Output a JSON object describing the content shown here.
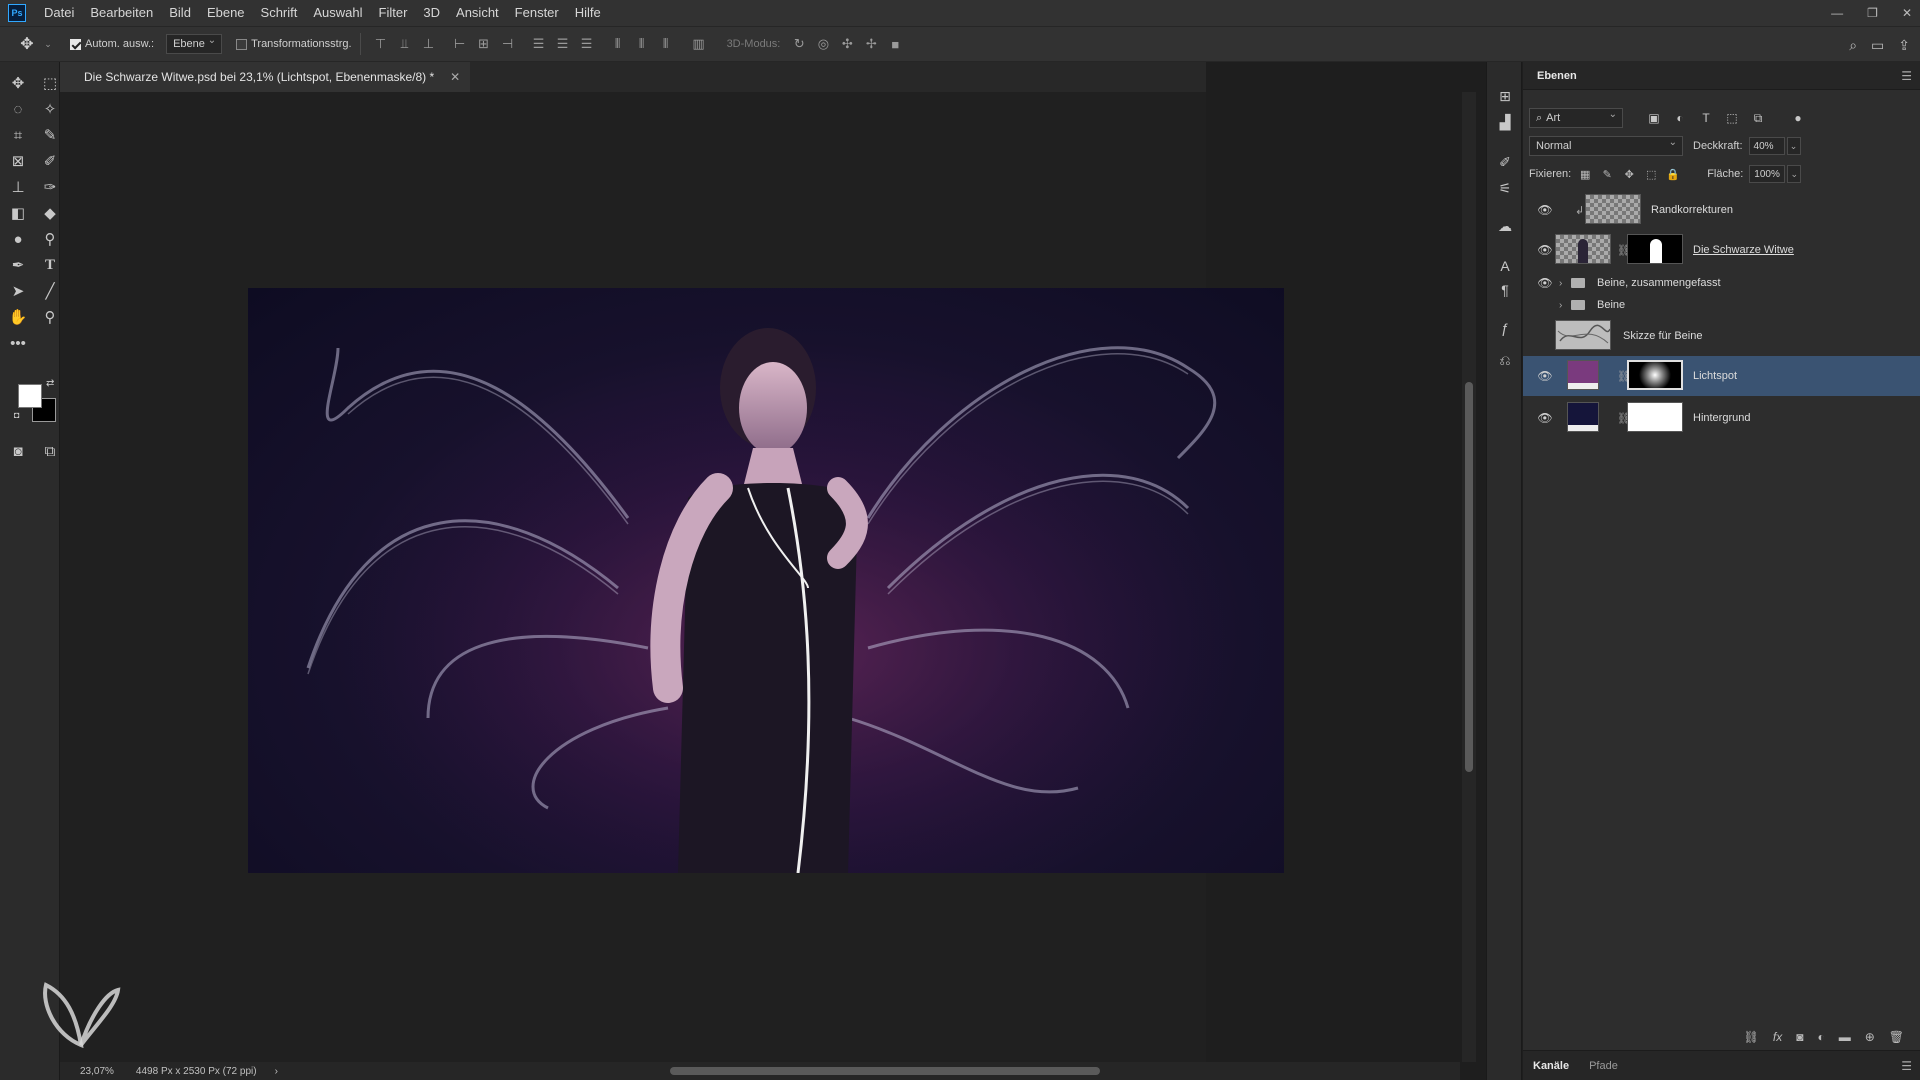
{
  "menubar": {
    "logo": "Ps",
    "items": [
      "Datei",
      "Bearbeiten",
      "Bild",
      "Ebene",
      "Schrift",
      "Auswahl",
      "Filter",
      "3D",
      "Ansicht",
      "Fenster",
      "Hilfe"
    ]
  },
  "options": {
    "auto_select_label": "Autom. ausw.:",
    "auto_select_checked": true,
    "auto_select_target": "Ebene",
    "transform_controls_label": "Transformationsstrg.",
    "transform_controls_checked": false,
    "mode_3d_label": "3D-Modus:"
  },
  "document": {
    "tab_title": "Die Schwarze Witwe.psd bei 23,1% (Lichtspot, Ebenenmaske/8) *",
    "zoom": "23,07%",
    "dimensions": "4498 Px x 2530 Px (72 ppi)"
  },
  "layers_panel": {
    "title": "Ebenen",
    "filter_kind": "Art",
    "blend_mode": "Normal",
    "opacity_label": "Deckkraft:",
    "opacity_value": "40%",
    "lock_label": "Fixieren:",
    "fill_label": "Fläche:",
    "fill_value": "100%",
    "layers": [
      {
        "name": "Randkorrekturen",
        "visible": true,
        "type": "clipped-pixel"
      },
      {
        "name": "Die Schwarze Witwe",
        "visible": true,
        "type": "smart-object-with-mask"
      },
      {
        "name": "Beine, zusammengefasst",
        "visible": true,
        "type": "group"
      },
      {
        "name": "Beine",
        "visible": false,
        "type": "group"
      },
      {
        "name": "Skizze für Beine",
        "visible": false,
        "type": "pixel"
      },
      {
        "name": "Lichtspot",
        "visible": true,
        "type": "fill-with-mask",
        "selected": true
      },
      {
        "name": "Hintergrund",
        "visible": true,
        "type": "fill-with-mask"
      }
    ]
  },
  "bottom_tabs": {
    "channels": "Kanäle",
    "paths": "Pfade"
  },
  "colors": {
    "selected_layer": "#3a5372",
    "lichtspot_fill": "#7a3a7e",
    "hintergrund_fill": "#15153a",
    "foreground": "#ffffff",
    "background": "#000000"
  }
}
